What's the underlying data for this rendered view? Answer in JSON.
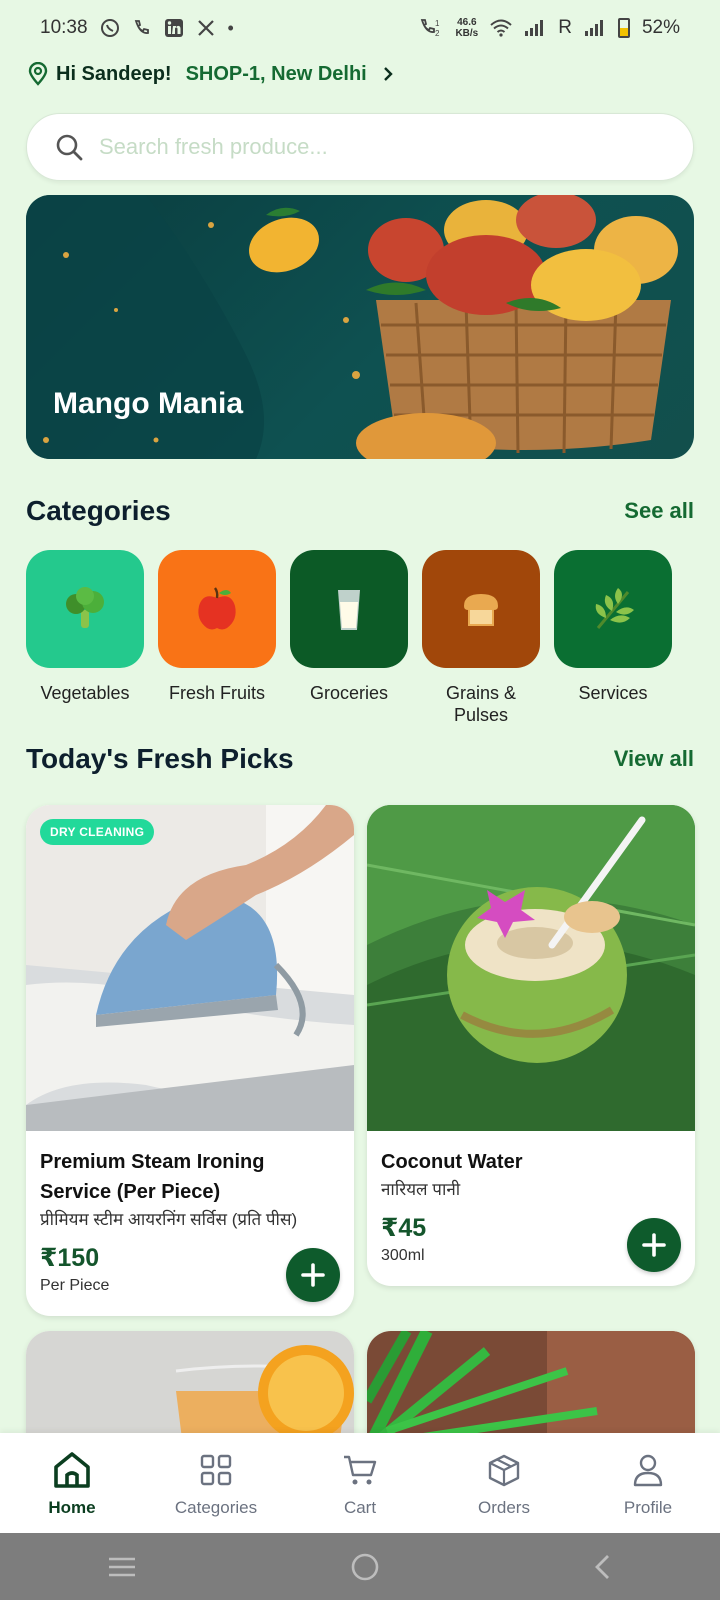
{
  "status": {
    "time": "10:38",
    "netspeed_value": "46.6",
    "netspeed_unit": "KB/s",
    "carrier_letter": "R",
    "battery": "52%"
  },
  "location": {
    "greeting": "Hi Sandeep!",
    "shop": "SHOP-1, New Delhi"
  },
  "search": {
    "placeholder": "Search fresh produce..."
  },
  "banner": {
    "title": "Mango Mania"
  },
  "categories": {
    "title": "Categories",
    "link": "See all",
    "items": [
      {
        "label": "Vegetables",
        "icon": "broccoli-icon",
        "color": "#24c98d"
      },
      {
        "label": "Fresh Fruits",
        "icon": "apple-icon",
        "color": "#f97316"
      },
      {
        "label": "Groceries",
        "icon": "milk-glass-icon",
        "color": "#0c5a26"
      },
      {
        "label": "Grains & Pulses",
        "icon": "bread-icon",
        "color": "#a1470a"
      },
      {
        "label": "Services",
        "icon": "leaf-icon",
        "color": "#0a6f32"
      }
    ]
  },
  "picks": {
    "title": "Today's Fresh Picks",
    "link": "View all",
    "products": [
      {
        "badge": "DRY CLEANING",
        "name": "Premium Steam Ironing Service (Per Piece)",
        "hindi": "प्रीमियम स्टीम आयरनिंग सर्विस (प्रति पीस)",
        "price": "₹150",
        "unit": "Per Piece"
      },
      {
        "name": "Coconut Water",
        "hindi": "नारियल पानी",
        "price": "₹45",
        "unit": "300ml"
      }
    ]
  },
  "nav": {
    "items": [
      {
        "label": "Home",
        "icon": "home-icon",
        "active": true
      },
      {
        "label": "Categories",
        "icon": "grid-icon"
      },
      {
        "label": "Cart",
        "icon": "cart-icon"
      },
      {
        "label": "Orders",
        "icon": "box-icon"
      },
      {
        "label": "Profile",
        "icon": "user-icon"
      }
    ]
  },
  "colors": {
    "background": "#e7f8e4",
    "brand_green": "#156a32",
    "button_green": "#0e5b2c",
    "banner_teal": "#0e5151"
  }
}
